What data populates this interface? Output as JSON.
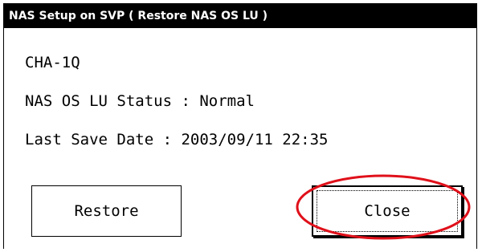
{
  "window": {
    "title": "NAS Setup on SVP ( Restore NAS OS LU )"
  },
  "info": {
    "channel": "CHA-1Q",
    "status_line": "NAS OS LU Status : Normal",
    "last_save_line": "Last Save Date : 2003/09/11 22:35"
  },
  "buttons": {
    "restore_label": "Restore",
    "close_label": "Close"
  },
  "annotation": {
    "highlight_color": "#e0101a"
  }
}
